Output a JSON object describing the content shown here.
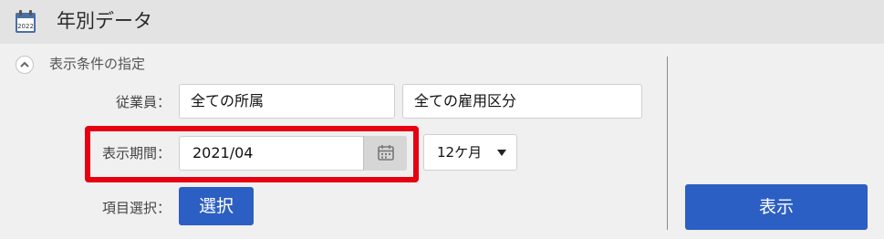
{
  "header": {
    "icon": "calendar-icon",
    "icon_text": "2022",
    "title": "年別データ"
  },
  "conditions": {
    "section_label": "表示条件の指定",
    "collapse_icon": "chevron-up-icon",
    "employee": {
      "label": "従業員：",
      "affiliation_value": "全ての所属",
      "employment_type_value": "全ての雇用区分"
    },
    "period": {
      "label": "表示期間：",
      "date_value": "2021/04",
      "calendar_icon": "calendar-icon",
      "span_value": "12ケ月",
      "span_arrow_icon": "caret-down-icon"
    },
    "items": {
      "label": "項目選択：",
      "select_button": "選択"
    }
  },
  "actions": {
    "show_button": "表示"
  },
  "colors": {
    "primary": "#2c5fc4",
    "highlight": "#e60012",
    "header_bg": "#e3e3e3",
    "page_bg": "#f0f0f0"
  }
}
